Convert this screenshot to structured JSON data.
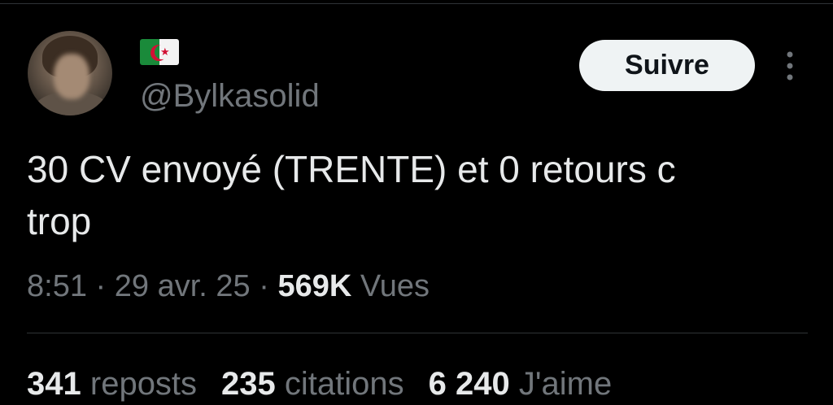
{
  "author": {
    "flag_emoji": "Algeria flag",
    "handle": "@Bylkasolid"
  },
  "follow_button": {
    "label": "Suivre"
  },
  "more_icon": "more-vertical-icon",
  "tweet": {
    "text_line1": "30 CV envoyé (TRENTE) et 0 retours c",
    "text_line2": "trop"
  },
  "meta": {
    "time": "8:51",
    "separator": "·",
    "date": "29 avr. 25",
    "views_count": "569K",
    "views_label": "Vues"
  },
  "stats": {
    "reposts_count": "341",
    "reposts_label": "reposts",
    "quotes_count": "235",
    "quotes_label": "citations",
    "likes_count": "6 240",
    "likes_label": "J'aime"
  },
  "colors": {
    "background": "#000000",
    "text_primary": "#e7e9ea",
    "text_secondary": "#71767b",
    "divider": "#2f3336",
    "button_bg": "#eff3f4"
  }
}
